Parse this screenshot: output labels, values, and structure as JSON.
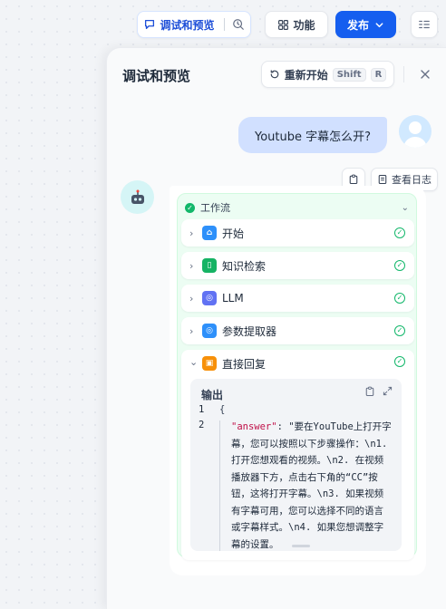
{
  "topbar": {
    "debug_label": "调试和预览",
    "feature_label": "功能",
    "publish_label": "发布"
  },
  "panel": {
    "title": "调试和预览",
    "restart_label": "重新开始",
    "shortcut_keys": [
      "Shift",
      "R"
    ]
  },
  "chat": {
    "user_message": "Youtube 字幕怎么开?",
    "view_log_label": "查看日志"
  },
  "workflow": {
    "header_label": "工作流",
    "nodes": [
      {
        "label": "开始",
        "icon": "home-icon",
        "color": "#2e90fa"
      },
      {
        "label": "知识检索",
        "icon": "book-icon",
        "color": "#16b364"
      },
      {
        "label": "LLM",
        "icon": "brain-icon",
        "color": "#6172f3"
      },
      {
        "label": "参数提取器",
        "icon": "extract-icon",
        "color": "#2e90fa"
      },
      {
        "label": "直接回复",
        "icon": "reply-icon",
        "color": "#f79009"
      }
    ],
    "output": {
      "title": "输出",
      "line_numbers": [
        "1",
        "2"
      ],
      "open_brace": "{",
      "key": "\"answer\"",
      "colon": ": ",
      "value": "\"要在YouTube上打开字幕，您可以按照以下步骤操作：\\n1. 打开您想观看的视频。\\n2. 在视频播放器下方，点击右下角的“CC”按钮，这将打开字幕。\\n3. 如果视频有字幕可用，您可以选择不同的语言或字幕样式。\\n4. 如果您想调整字幕的设置。"
    }
  }
}
